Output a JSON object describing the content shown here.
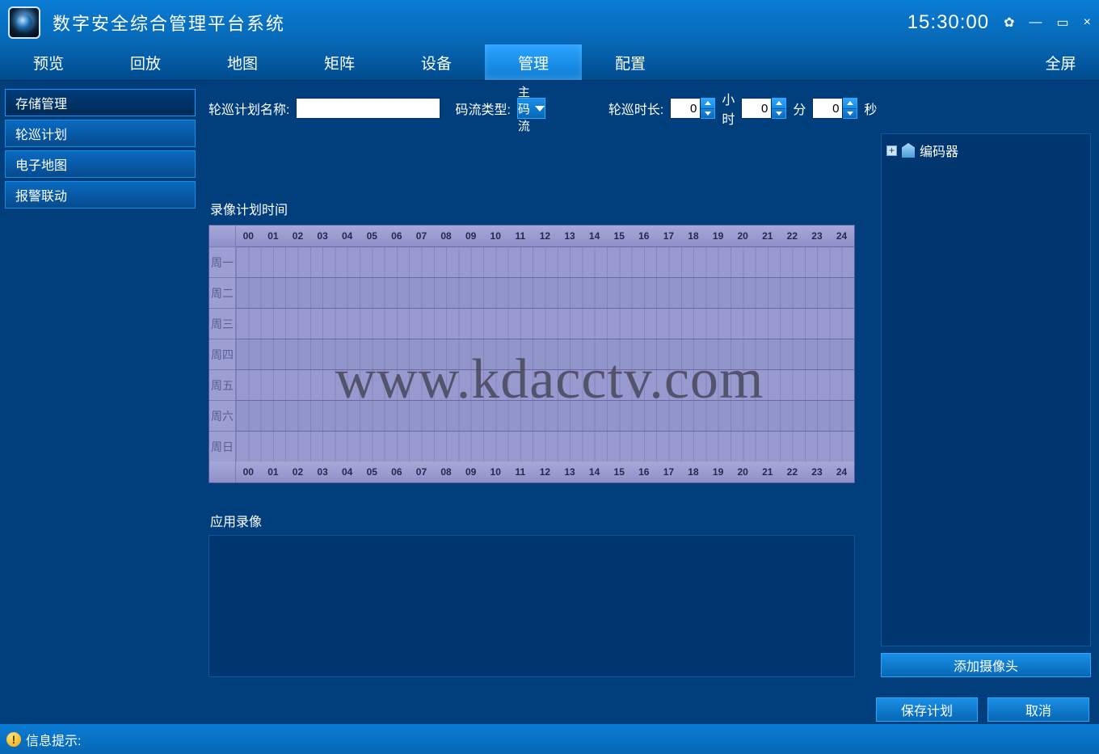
{
  "header": {
    "title": "数字安全综合管理平台系统",
    "clock": "15:30:00"
  },
  "nav": {
    "items": [
      "预览",
      "回放",
      "地图",
      "矩阵",
      "设备",
      "管理",
      "配置"
    ],
    "active_index": 5,
    "fullscreen": "全屏"
  },
  "sidebar": {
    "items": [
      "存储管理",
      "轮巡计划",
      "电子地图",
      "报警联动"
    ],
    "selected_index": 0
  },
  "form": {
    "plan_name_label": "轮巡计划名称:",
    "plan_name_value": "",
    "stream_type_label": "码流类型:",
    "stream_type_value": "主码流",
    "duration_label": "轮巡时长:",
    "hours_value": "0",
    "hours_unit": "小时",
    "minutes_value": "0",
    "minutes_unit": "分",
    "seconds_value": "0",
    "seconds_unit": "秒"
  },
  "schedule": {
    "title": "录像计划时间",
    "hours": [
      "00",
      "01",
      "02",
      "03",
      "04",
      "05",
      "06",
      "07",
      "08",
      "09",
      "10",
      "11",
      "12",
      "13",
      "14",
      "15",
      "16",
      "17",
      "18",
      "19",
      "20",
      "21",
      "22",
      "23",
      "24"
    ],
    "days": [
      "周一",
      "周二",
      "周三",
      "周四",
      "周五",
      "周六",
      "周日"
    ]
  },
  "applied_recording": {
    "title": "应用录像"
  },
  "tree": {
    "root_label": "编码器"
  },
  "buttons": {
    "add_camera": "添加摄像头",
    "save_plan": "保存计划",
    "cancel": "取消"
  },
  "status": {
    "label": "信息提示:"
  },
  "watermark": "www.kdacctv.com"
}
